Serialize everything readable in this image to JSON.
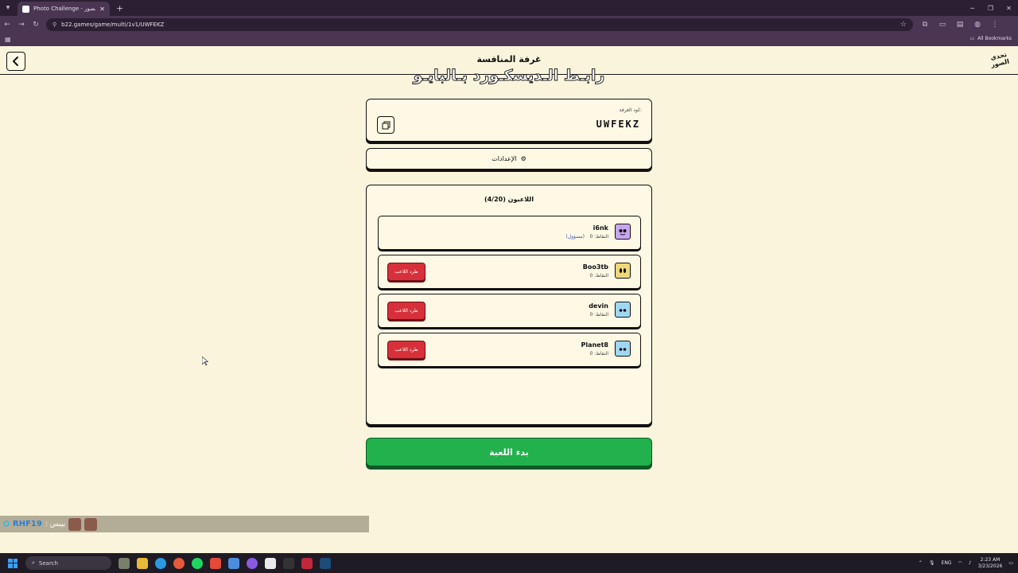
{
  "browser": {
    "tab_title": "Photo Challenge - تحدي الصور",
    "url": "b22.games/game/multi/1v1/UWFEKZ",
    "all_bookmarks": "All Bookmarks"
  },
  "header": {
    "title": "غرفة المنافسة",
    "overlay_text": "رابـط الـديسكـورد بـالبايـو",
    "logo_text": "تحدي الصور"
  },
  "room": {
    "code_label": "كود الغرفة:",
    "code": "UWFEKZ",
    "settings_label": "الإعدادات"
  },
  "players": {
    "title": "اللاعبون (4/20)",
    "list": [
      {
        "name": "i6nk",
        "score": "النقاط: 0",
        "host": "(مسؤول)",
        "avatar_color": "#c7a6ef"
      },
      {
        "name": "Boo3tb",
        "score": "النقاط: 0",
        "kick": "طرد اللاعب",
        "avatar_color": "#f0d77a"
      },
      {
        "name": "devin",
        "score": "النقاط: 0",
        "kick": "طرد اللاعب",
        "avatar_color": "#9fd8f3"
      },
      {
        "name": "Planet8",
        "score": "النقاط: 0",
        "kick": "طرد اللاعب",
        "avatar_color": "#9fd8f3"
      }
    ]
  },
  "start_label": "بدء اللعبة",
  "stream_chat": {
    "username": "RHF19",
    "message": ": بيبس"
  },
  "taskbar": {
    "search_placeholder": "Search",
    "lang": "ENG",
    "time": "2:23 AM",
    "date": "3/23/2026"
  },
  "colors": {
    "background": "#fbf4dc",
    "start_button": "#22b14c",
    "kick_button": "#d7303a"
  }
}
